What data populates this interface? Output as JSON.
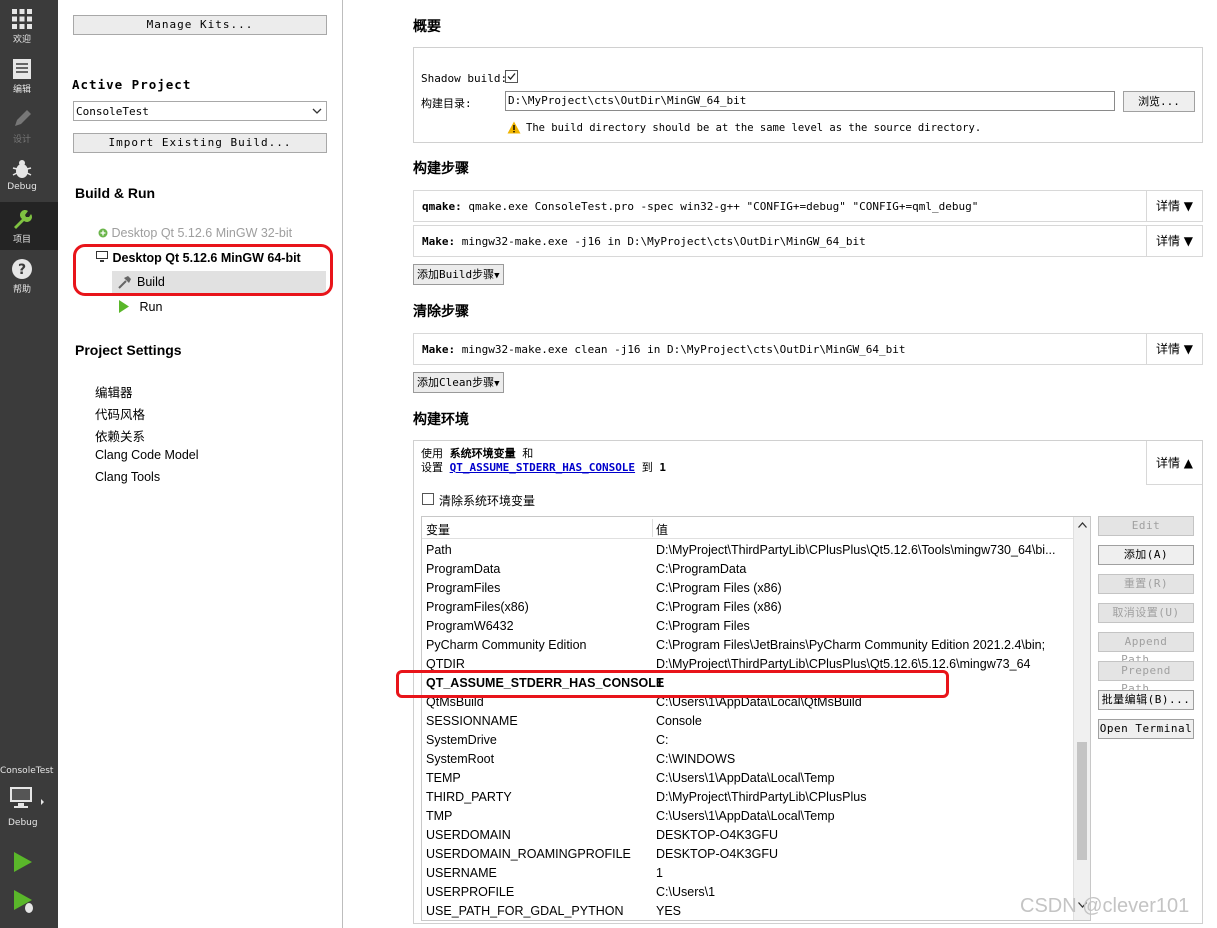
{
  "modebar": {
    "items": [
      {
        "label": "欢迎",
        "icon": "grid-icon"
      },
      {
        "label": "编辑",
        "icon": "document-icon"
      },
      {
        "label": "设计",
        "icon": "pencil-icon"
      },
      {
        "label": "Debug",
        "icon": "bug-icon"
      },
      {
        "label": "项目",
        "icon": "wrench-icon"
      },
      {
        "label": "帮助",
        "icon": "help-icon"
      }
    ],
    "target_project": "ConsoleTest",
    "target_mode": "Debug"
  },
  "left": {
    "manage_kits": "Manage Kits...",
    "active_project_label": "Active Project",
    "active_project_value": "ConsoleTest",
    "import_build": "Import Existing Build...",
    "build_run_heading": "Build & Run",
    "kit_32": "Desktop Qt 5.12.6 MinGW 32-bit",
    "kit_64": "Desktop Qt 5.12.6 MinGW 64-bit",
    "build": "Build",
    "run": "Run",
    "project_settings_heading": "Project Settings",
    "settings": [
      "编辑器",
      "代码风格",
      "依赖关系",
      "Clang Code Model",
      "Clang Tools"
    ]
  },
  "main": {
    "overview_heading": "概要",
    "shadow_build_label": "Shadow build:",
    "build_dir_label": "构建目录:",
    "build_dir_value": "D:\\MyProject\\cts\\OutDir\\MinGW_64_bit",
    "browse_button": "浏览...",
    "warning": "The build directory should be at the same level as the source directory.",
    "build_steps_heading": "构建步骤",
    "qmake_step_name": "qmake:",
    "qmake_step_cmd": "qmake.exe ConsoleTest.pro -spec win32-g++ \"CONFIG+=debug\" \"CONFIG+=qml_debug\"",
    "make_step_name": "Make:",
    "make_step_cmd": "mingw32-make.exe -j16 in D:\\MyProject\\cts\\OutDir\\MinGW_64_bit",
    "details": "详情",
    "add_build_step": "添加Build步骤",
    "clean_steps_heading": "清除步骤",
    "clean_step_name": "Make:",
    "clean_step_cmd": "mingw32-make.exe clean -j16 in D:\\MyProject\\cts\\OutDir\\MinGW_64_bit",
    "add_clean_step": "添加Clean步骤",
    "env_heading": "构建环境",
    "env_summary_use": "使用",
    "env_summary_sysenv": "系统环境变量",
    "env_summary_and": "和",
    "env_summary_set": "设置",
    "env_summary_var": "QT_ASSUME_STDERR_HAS_CONSOLE",
    "env_summary_to": "到",
    "env_summary_val": "1",
    "clear_sys_env": "清除系统环境变量",
    "col_var": "变量",
    "col_val": "值",
    "buttons": [
      "Edit",
      "添加(A)",
      "重置(R)",
      "取消设置(U)",
      "Append Path...",
      "Prepend Path...",
      "批量编辑(B)...",
      "Open Terminal"
    ],
    "rows": [
      [
        "Path",
        "D:\\MyProject\\ThirdPartyLib\\CPlusPlus\\Qt5.12.6\\Tools\\mingw730_64\\bi..."
      ],
      [
        "ProgramData",
        "C:\\ProgramData"
      ],
      [
        "ProgramFiles",
        "C:\\Program Files (x86)"
      ],
      [
        "ProgramFiles(x86)",
        "C:\\Program Files (x86)"
      ],
      [
        "ProgramW6432",
        "C:\\Program Files"
      ],
      [
        "PyCharm Community Edition",
        "C:\\Program Files\\JetBrains\\PyCharm Community Edition 2021.2.4\\bin;"
      ],
      [
        "QTDIR",
        "D:\\MyProject\\ThirdPartyLib\\CPlusPlus\\Qt5.12.6\\5.12.6\\mingw73_64"
      ],
      [
        "QT_ASSUME_STDERR_HAS_CONSOLE",
        "1"
      ],
      [
        "QtMsBuild",
        "C:\\Users\\1\\AppData\\Local\\QtMsBuild"
      ],
      [
        "SESSIONNAME",
        "Console"
      ],
      [
        "SystemDrive",
        "C:"
      ],
      [
        "SystemRoot",
        "C:\\WINDOWS"
      ],
      [
        "TEMP",
        "C:\\Users\\1\\AppData\\Local\\Temp"
      ],
      [
        "THIRD_PARTY",
        "D:\\MyProject\\ThirdPartyLib\\CPlusPlus"
      ],
      [
        "TMP",
        "C:\\Users\\1\\AppData\\Local\\Temp"
      ],
      [
        "USERDOMAIN",
        "DESKTOP-O4K3GFU"
      ],
      [
        "USERDOMAIN_ROAMINGPROFILE",
        "DESKTOP-O4K3GFU"
      ],
      [
        "USERNAME",
        "1"
      ],
      [
        "USERPROFILE",
        "C:\\Users\\1"
      ],
      [
        "USE_PATH_FOR_GDAL_PYTHON",
        "YES"
      ]
    ]
  },
  "watermark": "CSDN @clever101",
  "colors": {
    "highlight_red": "#e8141a",
    "link_blue": "#0000cc",
    "warning_yellow": "#f0b400"
  }
}
